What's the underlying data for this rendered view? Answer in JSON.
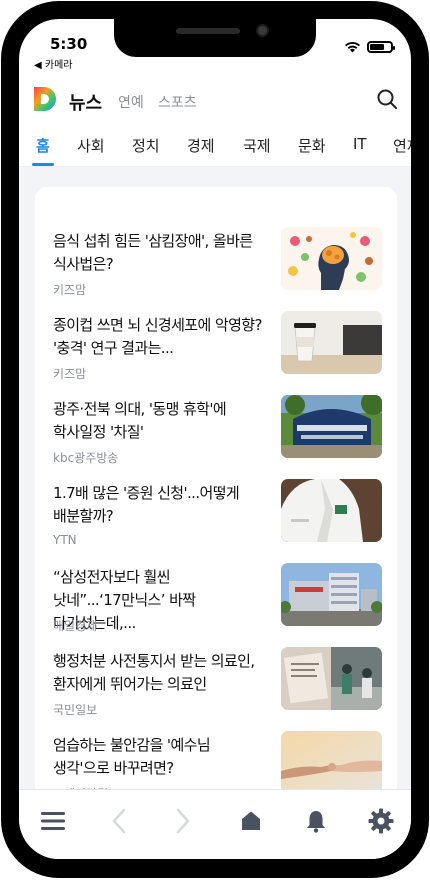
{
  "status": {
    "time": "5:30",
    "back_label": "◀ 카메라"
  },
  "app": {
    "title": "뉴스",
    "nav_links": [
      "연예",
      "스포츠"
    ]
  },
  "tabs": [
    "홈",
    "사회",
    "정치",
    "경제",
    "국제",
    "문화",
    "IT",
    "연재"
  ],
  "active_tab": "홈",
  "news": [
    {
      "title": "음식 섭취 힘든 '삼킴장애', 올바른 식사법은?",
      "source": "키즈맘",
      "thumb": "brain-food-illustration"
    },
    {
      "title": "종이컵 쓰면 뇌 신경세포에 악영향? '충격' 연구 결과는...",
      "source": "키즈맘",
      "thumb": "paper-cup-photo"
    },
    {
      "title": "광주·전북 의대, '동맹 휴학'에 학사일정 '차질'",
      "source": "kbc광주방송",
      "thumb": "medical-school-sign-photo"
    },
    {
      "title": "1.7배 많은 '증원 신청'...어떻게 배분할까?",
      "source": "YTN",
      "thumb": "doctor-coat-photo"
    },
    {
      "title": "“삼성전자보다 훨씬 낫네”...‘17만닉스’ 바짝 다가섰는데,...",
      "source": "매일경제",
      "thumb": "factory-building-photo"
    },
    {
      "title": "행정처분 사전통지서 받는 의료인, 환자에게 뛰어가는 의료인",
      "source": "국민일보",
      "thumb": "hospital-scene-photo"
    },
    {
      "title": "엄습하는 불안감을 '예수님 생각'으로 바꾸려면?",
      "source": "코메디닷컴",
      "thumb": "holding-hands-photo"
    }
  ],
  "bottom_bar": [
    "menu-icon",
    "back-icon",
    "forward-icon",
    "home-icon",
    "bell-icon",
    "gear-icon"
  ],
  "colors": {
    "accent": "#1e88e5",
    "background": "#f3f4f7",
    "source_text": "#8a8f99"
  }
}
